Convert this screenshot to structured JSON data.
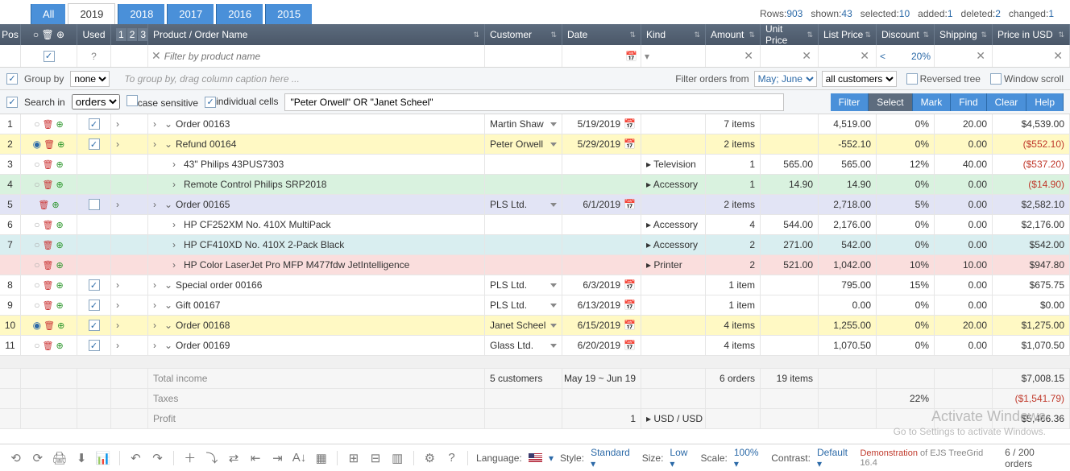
{
  "tabs": [
    "All",
    "2019",
    "2018",
    "2017",
    "2016",
    "2015"
  ],
  "active_tab": "2019",
  "stats": {
    "rows": "903",
    "shown": "43",
    "selected": "10",
    "added": "1",
    "deleted": "2",
    "changed": "1"
  },
  "header": {
    "pos": "Pos",
    "used": "Used",
    "product": "Product / Order Name",
    "customer": "Customer",
    "date": "Date",
    "kind": "Kind",
    "amount": "Amount",
    "unit": "Unit Price",
    "list": "List Price",
    "discount": "Discount",
    "shipping": "Shipping",
    "usd": "Price in USD"
  },
  "filter": {
    "product_placeholder": "Filter by product name",
    "discount": "20%"
  },
  "toolbar1": {
    "groupby_label": "Group by",
    "groupby_value": "none",
    "group_hint": "To group by, drag column caption here ...",
    "filter_orders_label": "Filter orders from",
    "months": "May; June",
    "customers": "all customers",
    "reversed": "Reversed tree",
    "windowscroll": "Window scroll"
  },
  "toolbar2": {
    "searchin_label": "Search in",
    "searchin_value": "orders",
    "casesensitive": "case sensitive",
    "individual": "individual cells",
    "query": "\"Peter Orwell\" OR \"Janet Scheel\"",
    "btns": [
      "Filter",
      "Select",
      "Mark",
      "Find",
      "Clear",
      "Help"
    ]
  },
  "rows": [
    {
      "pos": "1",
      "cls": "",
      "used": true,
      "lvl": 0,
      "name": "Order 00163",
      "cust": "Martin Shaw",
      "date": "5/19/2019",
      "kind": "",
      "amt": "7 items",
      "unit": "",
      "list": "4,519.00",
      "disc": "0%",
      "ship": "20.00",
      "usd": "$4,539.00",
      "radio": "o"
    },
    {
      "pos": "2",
      "cls": "sel",
      "used": true,
      "lvl": 0,
      "name": "Refund 00164",
      "cust": "Peter Orwell",
      "date": "5/29/2019",
      "kind": "",
      "amt": "2 items",
      "unit": "",
      "list": "-552.10",
      "disc": "0%",
      "ship": "0.00",
      "usd": "($552.10)",
      "neg": true,
      "radio": "●"
    },
    {
      "pos": "3",
      "cls": "",
      "used": null,
      "lvl": 1,
      "name": "43\" Philips 43PUS7303",
      "cust": "",
      "date": "",
      "kind": "Television",
      "amt": "1",
      "unit": "565.00",
      "list": "565.00",
      "disc": "12%",
      "ship": "40.00",
      "usd": "($537.20)",
      "neg": true,
      "radio": "o"
    },
    {
      "pos": "4",
      "cls": "green",
      "used": null,
      "lvl": 1,
      "name": "Remote Control Philips SRP2018",
      "cust": "",
      "date": "",
      "kind": "Accessory",
      "amt": "1",
      "unit": "14.90",
      "list": "14.90",
      "disc": "0%",
      "ship": "0.00",
      "usd": "($14.90)",
      "neg": true,
      "radio": "o"
    },
    {
      "pos": "5",
      "cls": "blue",
      "used": false,
      "lvl": 0,
      "name": "Order 00165",
      "cust": "PLS Ltd.",
      "date": "6/1/2019",
      "kind": "",
      "amt": "2 items",
      "unit": "",
      "list": "2,718.00",
      "disc": "5%",
      "ship": "0.00",
      "usd": "$2,582.10",
      "radio": ""
    },
    {
      "pos": "6",
      "cls": "",
      "used": null,
      "lvl": 1,
      "name": "HP CF252XM No. 410X MultiPack",
      "cust": "",
      "date": "",
      "kind": "Accessory",
      "amt": "4",
      "unit": "544.00",
      "list": "2,176.00",
      "disc": "0%",
      "ship": "0.00",
      "usd": "$2,176.00",
      "radio": "o"
    },
    {
      "pos": "7",
      "cls": "teal",
      "used": null,
      "lvl": 1,
      "name": "HP CF410XD No. 410X 2-Pack Black",
      "cust": "",
      "date": "",
      "kind": "Accessory",
      "amt": "2",
      "unit": "271.00",
      "list": "542.00",
      "disc": "0%",
      "ship": "0.00",
      "usd": "$542.00",
      "radio": "o"
    },
    {
      "pos": "",
      "cls": "pink",
      "used": null,
      "lvl": 1,
      "name": "HP Color LaserJet Pro MFP M477fdw JetIntelligence",
      "cust": "",
      "date": "",
      "kind": "Printer",
      "amt": "2",
      "unit": "521.00",
      "list": "1,042.00",
      "disc": "10%",
      "ship": "10.00",
      "usd": "$947.80",
      "radio": "o"
    },
    {
      "pos": "8",
      "cls": "",
      "used": true,
      "lvl": 0,
      "name": "Special order 00166",
      "cust": "PLS Ltd.",
      "date": "6/3/2019",
      "kind": "",
      "amt": "1 item",
      "unit": "",
      "list": "795.00",
      "disc": "15%",
      "ship": "0.00",
      "usd": "$675.75",
      "radio": "o"
    },
    {
      "pos": "9",
      "cls": "",
      "used": true,
      "lvl": 0,
      "name": "Gift 00167",
      "cust": "PLS Ltd.",
      "date": "6/13/2019",
      "kind": "",
      "amt": "1 item",
      "unit": "",
      "list": "0.00",
      "disc": "0%",
      "ship": "0.00",
      "usd": "$0.00",
      "radio": "o"
    },
    {
      "pos": "10",
      "cls": "sel",
      "used": true,
      "lvl": 0,
      "name": "Order 00168",
      "cust": "Janet Scheel",
      "date": "6/15/2019",
      "kind": "",
      "amt": "4 items",
      "unit": "",
      "list": "1,255.00",
      "disc": "0%",
      "ship": "20.00",
      "usd": "$1,275.00",
      "radio": "●"
    },
    {
      "pos": "11",
      "cls": "",
      "used": true,
      "lvl": 0,
      "name": "Order 00169",
      "cust": "Glass Ltd.",
      "date": "6/20/2019",
      "kind": "",
      "amt": "4 items",
      "unit": "",
      "list": "1,070.50",
      "disc": "0%",
      "ship": "0.00",
      "usd": "$1,070.50",
      "radio": "o"
    }
  ],
  "summary": [
    {
      "label": "Total income",
      "cust": "5 customers",
      "date": "May 19 ~ Jun 19",
      "amt": "6 orders",
      "unit": "19 items",
      "usd": "$7,008.15"
    },
    {
      "label": "Taxes",
      "disc": "22%",
      "usd": "($1,541.79)",
      "neg": true
    },
    {
      "label": "Profit",
      "date": "1",
      "kind": "USD / USD",
      "usd": "$5,466.36"
    }
  ],
  "bottom": {
    "language": "Language:",
    "style": "Style:",
    "style_v": "Standard",
    "size": "Size:",
    "size_v": "Low",
    "scale": "Scale:",
    "scale_v": "100%",
    "contrast": "Contrast:",
    "contrast_v": "Default",
    "demo": "Demonstration",
    "demo2": " of EJS TreeGrid 16.4",
    "pager": "6 / 200 orders"
  },
  "watermark": {
    "t1": "Activate Windows",
    "t2": "Go to Settings to activate Windows."
  }
}
